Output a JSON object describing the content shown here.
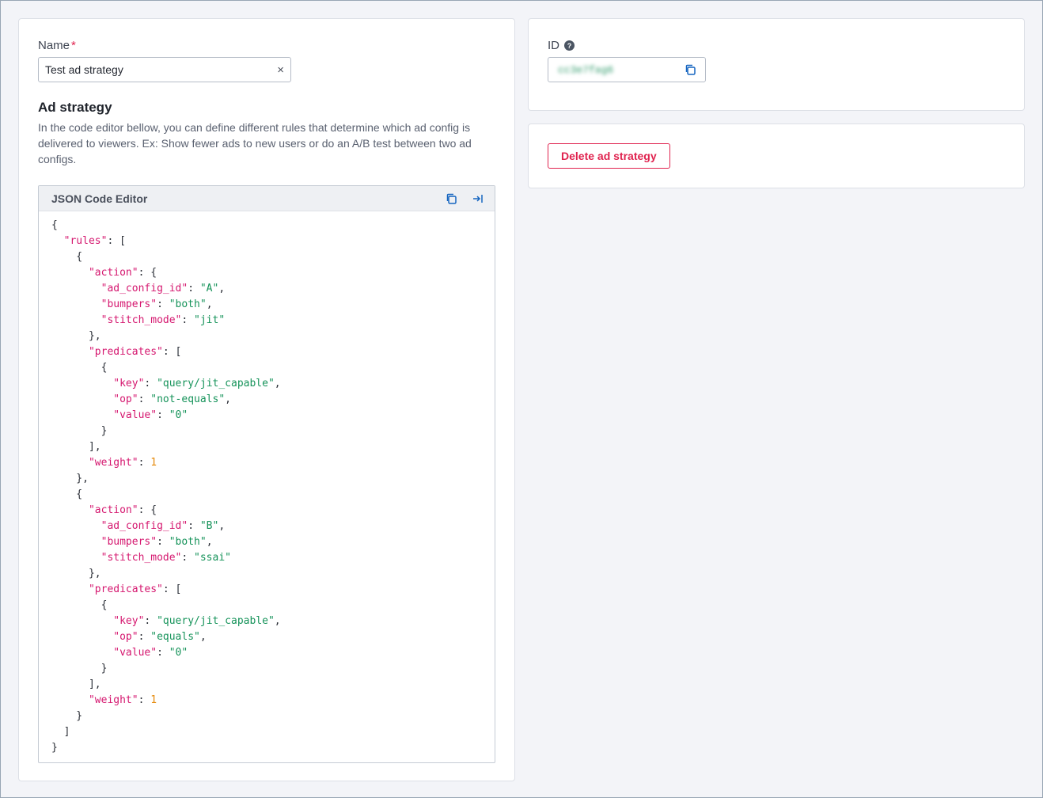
{
  "name_field": {
    "label": "Name",
    "required_mark": "*",
    "value": "Test ad strategy",
    "clear_glyph": "×"
  },
  "ad_strategy": {
    "title": "Ad strategy",
    "description": "In the code editor bellow, you can define different rules that determine which ad config is delivered to viewers. Ex: Show fewer ads to new users or do an A/B test between two ad configs."
  },
  "editor": {
    "title": "JSON Code Editor",
    "icons": [
      "copy-icon",
      "expand-icon"
    ],
    "code": {
      "rules": [
        {
          "action": {
            "ad_config_id": "A",
            "bumpers": "both",
            "stitch_mode": "jit"
          },
          "predicates": [
            {
              "key": "query/jit_capable",
              "op": "not-equals",
              "value": "0"
            }
          ],
          "weight": 1
        },
        {
          "action": {
            "ad_config_id": "B",
            "bumpers": "both",
            "stitch_mode": "ssai"
          },
          "predicates": [
            {
              "key": "query/jit_capable",
              "op": "equals",
              "value": "0"
            }
          ],
          "weight": 1
        }
      ]
    }
  },
  "id_field": {
    "label": "ID",
    "help_glyph": "?",
    "value": "cc3e7fag6"
  },
  "delete_button": {
    "label": "Delete ad strategy"
  },
  "colors": {
    "accent": "#1565c0",
    "danger": "#e0234f",
    "json_key": "#d5176f",
    "json_string": "#16935a",
    "json_number": "#e58a0b"
  }
}
